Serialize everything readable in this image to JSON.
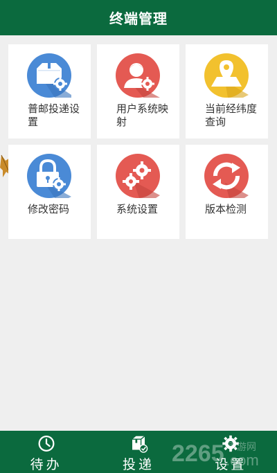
{
  "header": {
    "title": "终端管理"
  },
  "tiles": [
    {
      "label": "普邮投递设置",
      "icon": "package-gear-icon",
      "color": "#4a8ad6"
    },
    {
      "label": "用户系统映射",
      "icon": "user-gear-icon",
      "color": "#e45a53"
    },
    {
      "label": "当前经纬度查询",
      "icon": "map-pin-icon",
      "color": "#f2c12e"
    },
    {
      "label": "修改密码",
      "icon": "lock-gear-icon",
      "color": "#4a8ad6"
    },
    {
      "label": "系统设置",
      "icon": "gears-icon",
      "color": "#e45a53"
    },
    {
      "label": "版本检测",
      "icon": "refresh-icon",
      "color": "#e45a53"
    }
  ],
  "tabbar": {
    "tabs": [
      {
        "label": "待办",
        "icon": "clock-icon"
      },
      {
        "label": "投递",
        "icon": "delivery-box-icon"
      },
      {
        "label": "设置",
        "icon": "gear-icon"
      }
    ]
  },
  "watermark": {
    "number": "2265",
    "site": "手游网",
    "domain": ".com"
  },
  "colors": {
    "primary": "#0b6a3e",
    "background": "#efefef",
    "tile": "#ffffff"
  }
}
